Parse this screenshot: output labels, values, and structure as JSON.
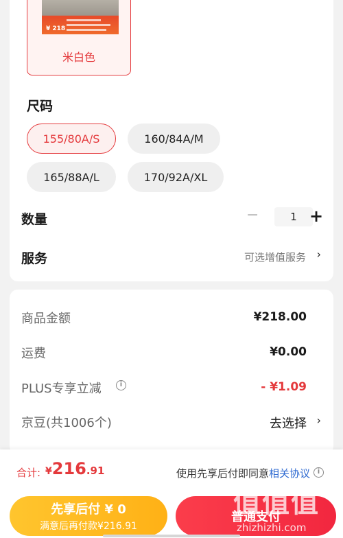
{
  "color": {
    "selected_label": "米白色",
    "thumb_price": "¥ 218"
  },
  "size": {
    "title": "尺码",
    "options": [
      "155/80A/S",
      "160/84A/M",
      "165/88A/L",
      "170/92A/XL"
    ],
    "selected": "155/80A/S"
  },
  "quantity": {
    "label": "数量",
    "minus": "−",
    "value": "1",
    "plus": "+"
  },
  "service": {
    "label": "服务",
    "value": "可选增值服务",
    "chevron": "›"
  },
  "price": {
    "rows": [
      {
        "label": "商品金额",
        "value": "¥218.00"
      },
      {
        "label": "运费",
        "value": "¥0.00"
      },
      {
        "label": "PLUS专享立减",
        "value": "- ¥1.09"
      },
      {
        "label": "京豆(共1006个)",
        "value": "去选择"
      }
    ],
    "info_icon": "i"
  },
  "bottom": {
    "total_label": "合计:",
    "total_currency": "¥",
    "total_int": "216",
    "total_dec": ".91",
    "agree_text": "使用先享后付即同意",
    "agree_link": "相关协议",
    "btn_xiang_line1": "先享后付 ¥ 0",
    "btn_xiang_line2": "满意后再付款¥216.91",
    "btn_pay": "普通支付"
  },
  "watermark": {
    "main": "值值值",
    "sub": "zhizhizhi.com"
  },
  "colors": {
    "accent_red": "#e4393c",
    "accent_yellow": "#ffb116",
    "link_blue": "#2e6ad1"
  }
}
